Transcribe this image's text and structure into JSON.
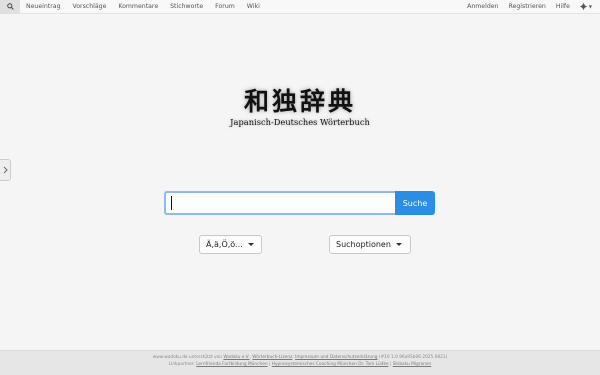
{
  "nav": {
    "left": [
      "Neueintrag",
      "Vorschläge",
      "Kommentare",
      "Stichworte",
      "Forum",
      "Wiki"
    ],
    "right": [
      "Anmelden",
      "Registrieren",
      "Hilfe"
    ]
  },
  "logo": {
    "title": "和独辞典",
    "subtitle": "Japanisch-Deutsches Wörterbuch"
  },
  "search": {
    "value": "",
    "button_label": "Suche"
  },
  "dropdowns": {
    "chars_label": "Ä,ä,Ö,ö...",
    "options_label": "Suchoptionen"
  },
  "footer": {
    "line1_prefix": "www.wadoku.de unterstützt von",
    "line1_link1": "Wadoku e.V.",
    "line1_link2": "Wörterbuch-Lizenz",
    "line1_link3": "Impressum und Datenschutzerklärung",
    "line1_suffix": "(#10 1.0 96a95b06 2025 0821)",
    "line2_prefix": "Linkpartner:",
    "line2_link1": "Lernfrienda Fortbildung München",
    "line2_link2": "Hypnosystemisches Coaching München Dr. Tom Lüdke",
    "line2_link3": "Shibaku Migranen"
  },
  "icons": {
    "search": "search-icon",
    "gear": "gear-icon",
    "side_toggle": "chevron-right-icon"
  },
  "colors": {
    "accent": "#2b8de3",
    "input_border": "#8cb9ee"
  }
}
